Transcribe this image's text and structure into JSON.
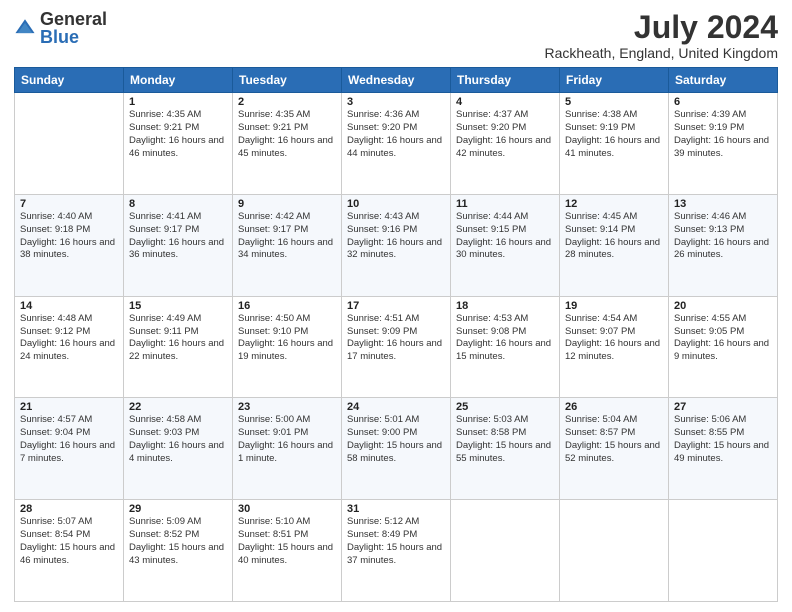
{
  "logo": {
    "general": "General",
    "blue": "Blue"
  },
  "header": {
    "month_year": "July 2024",
    "location": "Rackheath, England, United Kingdom"
  },
  "columns": [
    "Sunday",
    "Monday",
    "Tuesday",
    "Wednesday",
    "Thursday",
    "Friday",
    "Saturday"
  ],
  "weeks": [
    [
      {
        "day": "",
        "info": ""
      },
      {
        "day": "1",
        "info": "Sunrise: 4:35 AM\nSunset: 9:21 PM\nDaylight: 16 hours and 46 minutes."
      },
      {
        "day": "2",
        "info": "Sunrise: 4:35 AM\nSunset: 9:21 PM\nDaylight: 16 hours and 45 minutes."
      },
      {
        "day": "3",
        "info": "Sunrise: 4:36 AM\nSunset: 9:20 PM\nDaylight: 16 hours and 44 minutes."
      },
      {
        "day": "4",
        "info": "Sunrise: 4:37 AM\nSunset: 9:20 PM\nDaylight: 16 hours and 42 minutes."
      },
      {
        "day": "5",
        "info": "Sunrise: 4:38 AM\nSunset: 9:19 PM\nDaylight: 16 hours and 41 minutes."
      },
      {
        "day": "6",
        "info": "Sunrise: 4:39 AM\nSunset: 9:19 PM\nDaylight: 16 hours and 39 minutes."
      }
    ],
    [
      {
        "day": "7",
        "info": "Sunrise: 4:40 AM\nSunset: 9:18 PM\nDaylight: 16 hours and 38 minutes."
      },
      {
        "day": "8",
        "info": "Sunrise: 4:41 AM\nSunset: 9:17 PM\nDaylight: 16 hours and 36 minutes."
      },
      {
        "day": "9",
        "info": "Sunrise: 4:42 AM\nSunset: 9:17 PM\nDaylight: 16 hours and 34 minutes."
      },
      {
        "day": "10",
        "info": "Sunrise: 4:43 AM\nSunset: 9:16 PM\nDaylight: 16 hours and 32 minutes."
      },
      {
        "day": "11",
        "info": "Sunrise: 4:44 AM\nSunset: 9:15 PM\nDaylight: 16 hours and 30 minutes."
      },
      {
        "day": "12",
        "info": "Sunrise: 4:45 AM\nSunset: 9:14 PM\nDaylight: 16 hours and 28 minutes."
      },
      {
        "day": "13",
        "info": "Sunrise: 4:46 AM\nSunset: 9:13 PM\nDaylight: 16 hours and 26 minutes."
      }
    ],
    [
      {
        "day": "14",
        "info": "Sunrise: 4:48 AM\nSunset: 9:12 PM\nDaylight: 16 hours and 24 minutes."
      },
      {
        "day": "15",
        "info": "Sunrise: 4:49 AM\nSunset: 9:11 PM\nDaylight: 16 hours and 22 minutes."
      },
      {
        "day": "16",
        "info": "Sunrise: 4:50 AM\nSunset: 9:10 PM\nDaylight: 16 hours and 19 minutes."
      },
      {
        "day": "17",
        "info": "Sunrise: 4:51 AM\nSunset: 9:09 PM\nDaylight: 16 hours and 17 minutes."
      },
      {
        "day": "18",
        "info": "Sunrise: 4:53 AM\nSunset: 9:08 PM\nDaylight: 16 hours and 15 minutes."
      },
      {
        "day": "19",
        "info": "Sunrise: 4:54 AM\nSunset: 9:07 PM\nDaylight: 16 hours and 12 minutes."
      },
      {
        "day": "20",
        "info": "Sunrise: 4:55 AM\nSunset: 9:05 PM\nDaylight: 16 hours and 9 minutes."
      }
    ],
    [
      {
        "day": "21",
        "info": "Sunrise: 4:57 AM\nSunset: 9:04 PM\nDaylight: 16 hours and 7 minutes."
      },
      {
        "day": "22",
        "info": "Sunrise: 4:58 AM\nSunset: 9:03 PM\nDaylight: 16 hours and 4 minutes."
      },
      {
        "day": "23",
        "info": "Sunrise: 5:00 AM\nSunset: 9:01 PM\nDaylight: 16 hours and 1 minute."
      },
      {
        "day": "24",
        "info": "Sunrise: 5:01 AM\nSunset: 9:00 PM\nDaylight: 15 hours and 58 minutes."
      },
      {
        "day": "25",
        "info": "Sunrise: 5:03 AM\nSunset: 8:58 PM\nDaylight: 15 hours and 55 minutes."
      },
      {
        "day": "26",
        "info": "Sunrise: 5:04 AM\nSunset: 8:57 PM\nDaylight: 15 hours and 52 minutes."
      },
      {
        "day": "27",
        "info": "Sunrise: 5:06 AM\nSunset: 8:55 PM\nDaylight: 15 hours and 49 minutes."
      }
    ],
    [
      {
        "day": "28",
        "info": "Sunrise: 5:07 AM\nSunset: 8:54 PM\nDaylight: 15 hours and 46 minutes."
      },
      {
        "day": "29",
        "info": "Sunrise: 5:09 AM\nSunset: 8:52 PM\nDaylight: 15 hours and 43 minutes."
      },
      {
        "day": "30",
        "info": "Sunrise: 5:10 AM\nSunset: 8:51 PM\nDaylight: 15 hours and 40 minutes."
      },
      {
        "day": "31",
        "info": "Sunrise: 5:12 AM\nSunset: 8:49 PM\nDaylight: 15 hours and 37 minutes."
      },
      {
        "day": "",
        "info": ""
      },
      {
        "day": "",
        "info": ""
      },
      {
        "day": "",
        "info": ""
      }
    ]
  ]
}
